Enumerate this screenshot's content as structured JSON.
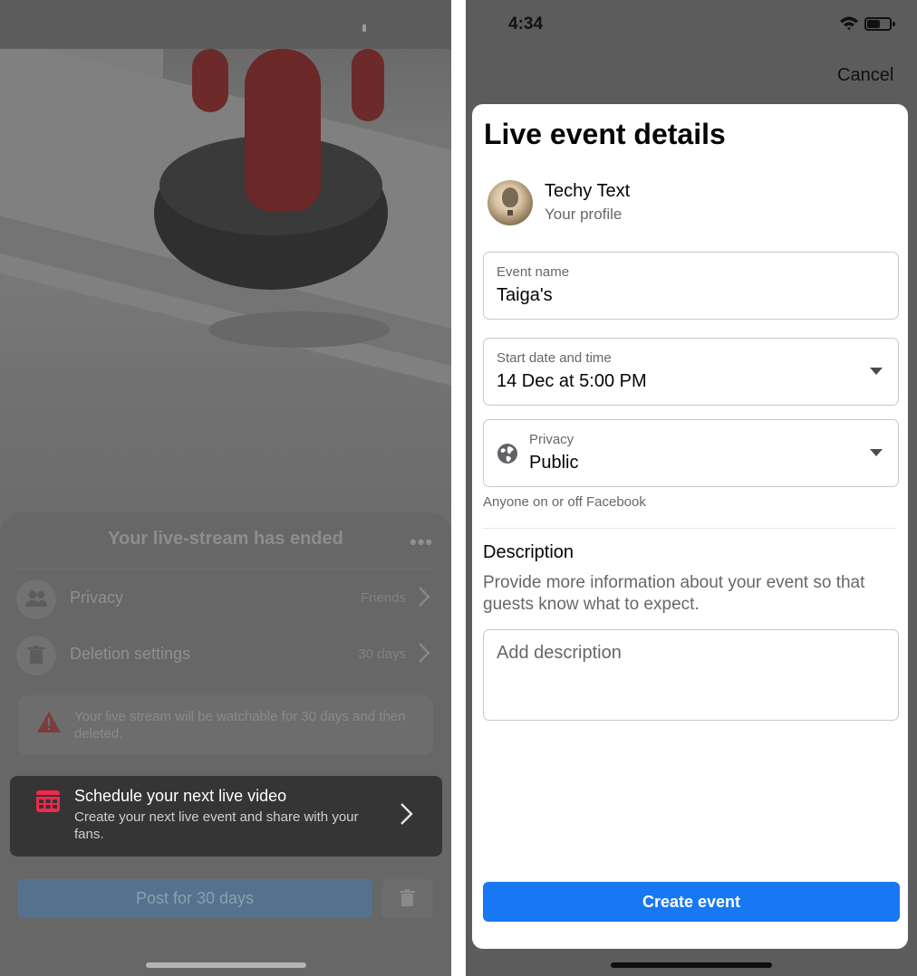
{
  "left_screen": {
    "sheet_title": "Your live-stream has ended",
    "more_label": "•••",
    "privacy": {
      "label": "Privacy",
      "value": "Friends"
    },
    "deletion": {
      "label": "Deletion settings",
      "value": "30 days"
    },
    "warning_text": "Your live stream will be watchable for 30 days and then deleted.",
    "schedule": {
      "title": "Schedule your next live video",
      "subtitle": "Create your next live event and share with your fans."
    },
    "post_button": "Post for 30 days"
  },
  "right_screen": {
    "status_time": "4:34",
    "cancel_label": "Cancel",
    "title": "Live event details",
    "profile": {
      "name": "Techy Text",
      "subtitle": "Your profile"
    },
    "event_name": {
      "label": "Event name",
      "value": "Taiga's"
    },
    "start_date": {
      "label": "Start date and time",
      "value": "14 Dec at 5:00 PM"
    },
    "privacy": {
      "label": "Privacy",
      "value": "Public",
      "help": "Anyone on or off Facebook"
    },
    "description": {
      "heading": "Description",
      "help": "Provide more information about your event so that guests know what to expect.",
      "placeholder": "Add description"
    },
    "create_button": "Create event",
    "accent_color": "#1877f2"
  }
}
